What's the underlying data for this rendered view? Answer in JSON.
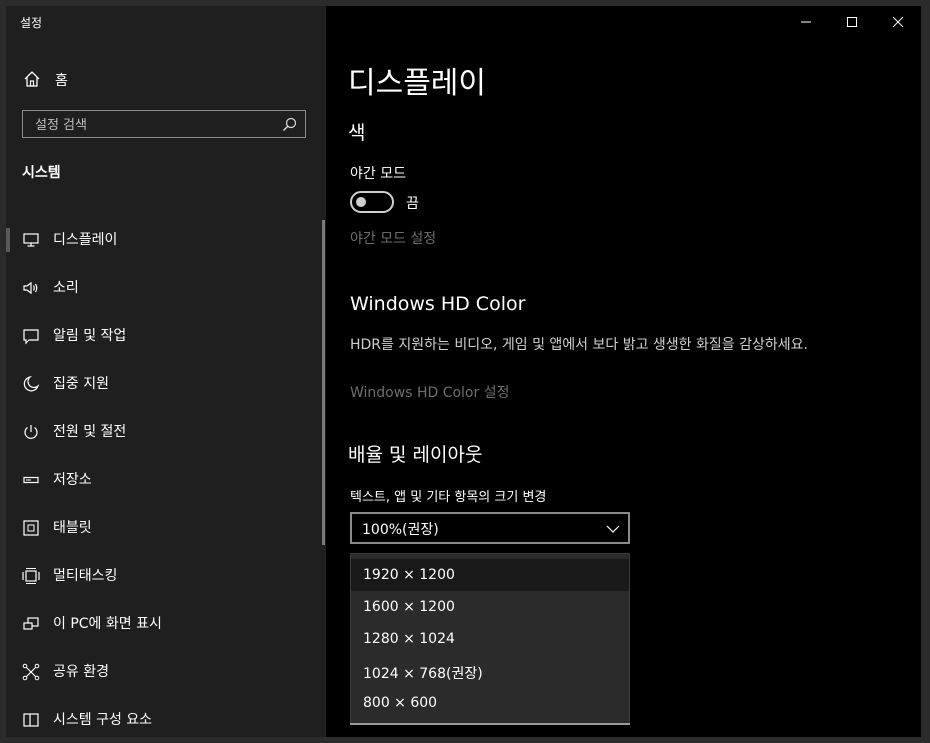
{
  "window": {
    "app_title": "설정",
    "minimize_icon": "minimize-icon",
    "maximize_icon": "maximize-icon",
    "close_icon": "close-icon"
  },
  "sidebar": {
    "home_label": "홈",
    "search_placeholder": "설정 검색",
    "section_title": "시스템",
    "items": [
      {
        "label": "디스플레이",
        "icon": "monitor-icon",
        "selected": true
      },
      {
        "label": "소리",
        "icon": "speaker-icon"
      },
      {
        "label": "알림 및 작업",
        "icon": "notification-icon"
      },
      {
        "label": "집중 지원",
        "icon": "moon-icon"
      },
      {
        "label": "전원 및 절전",
        "icon": "power-icon"
      },
      {
        "label": "저장소",
        "icon": "storage-icon"
      },
      {
        "label": "태블릿",
        "icon": "tablet-icon"
      },
      {
        "label": "멀티태스킹",
        "icon": "multitasking-icon"
      },
      {
        "label": "이 PC에 화면 표시",
        "icon": "projecting-icon"
      },
      {
        "label": "공유 환경",
        "icon": "shared-experiences-icon"
      },
      {
        "label": "시스템 구성 요소",
        "icon": "system-components-icon"
      }
    ]
  },
  "main": {
    "page_title": "디스플레이",
    "color_heading": "색",
    "night_light_label": "야간 모드",
    "night_light_state": "끔",
    "night_light_on": false,
    "night_light_settings_link": "야간 모드 설정",
    "hd_color_heading": "Windows HD Color",
    "hd_color_desc": "HDR를 지원하는 비디오, 게임 및 앱에서 보다 밝고 생생한 화질을 감상하세요.",
    "hd_color_settings_link": "Windows HD Color 설정",
    "scale_heading": "배율 및 레이아웃",
    "scale_label": "텍스트, 앱 및 기타 항목의 크기 변경",
    "scale_value": "100%(권장)",
    "resolution_options": [
      "1920 × 1200",
      "1600 × 1200",
      "1280 × 1024",
      "1024 × 768(권장)",
      "800 × 600"
    ]
  },
  "colors": {
    "sidebar_bg": "#1f1f1f",
    "content_bg": "#000000",
    "dropdown_bg": "#2b2b2b",
    "disabled_text": "#6e6e6e"
  }
}
